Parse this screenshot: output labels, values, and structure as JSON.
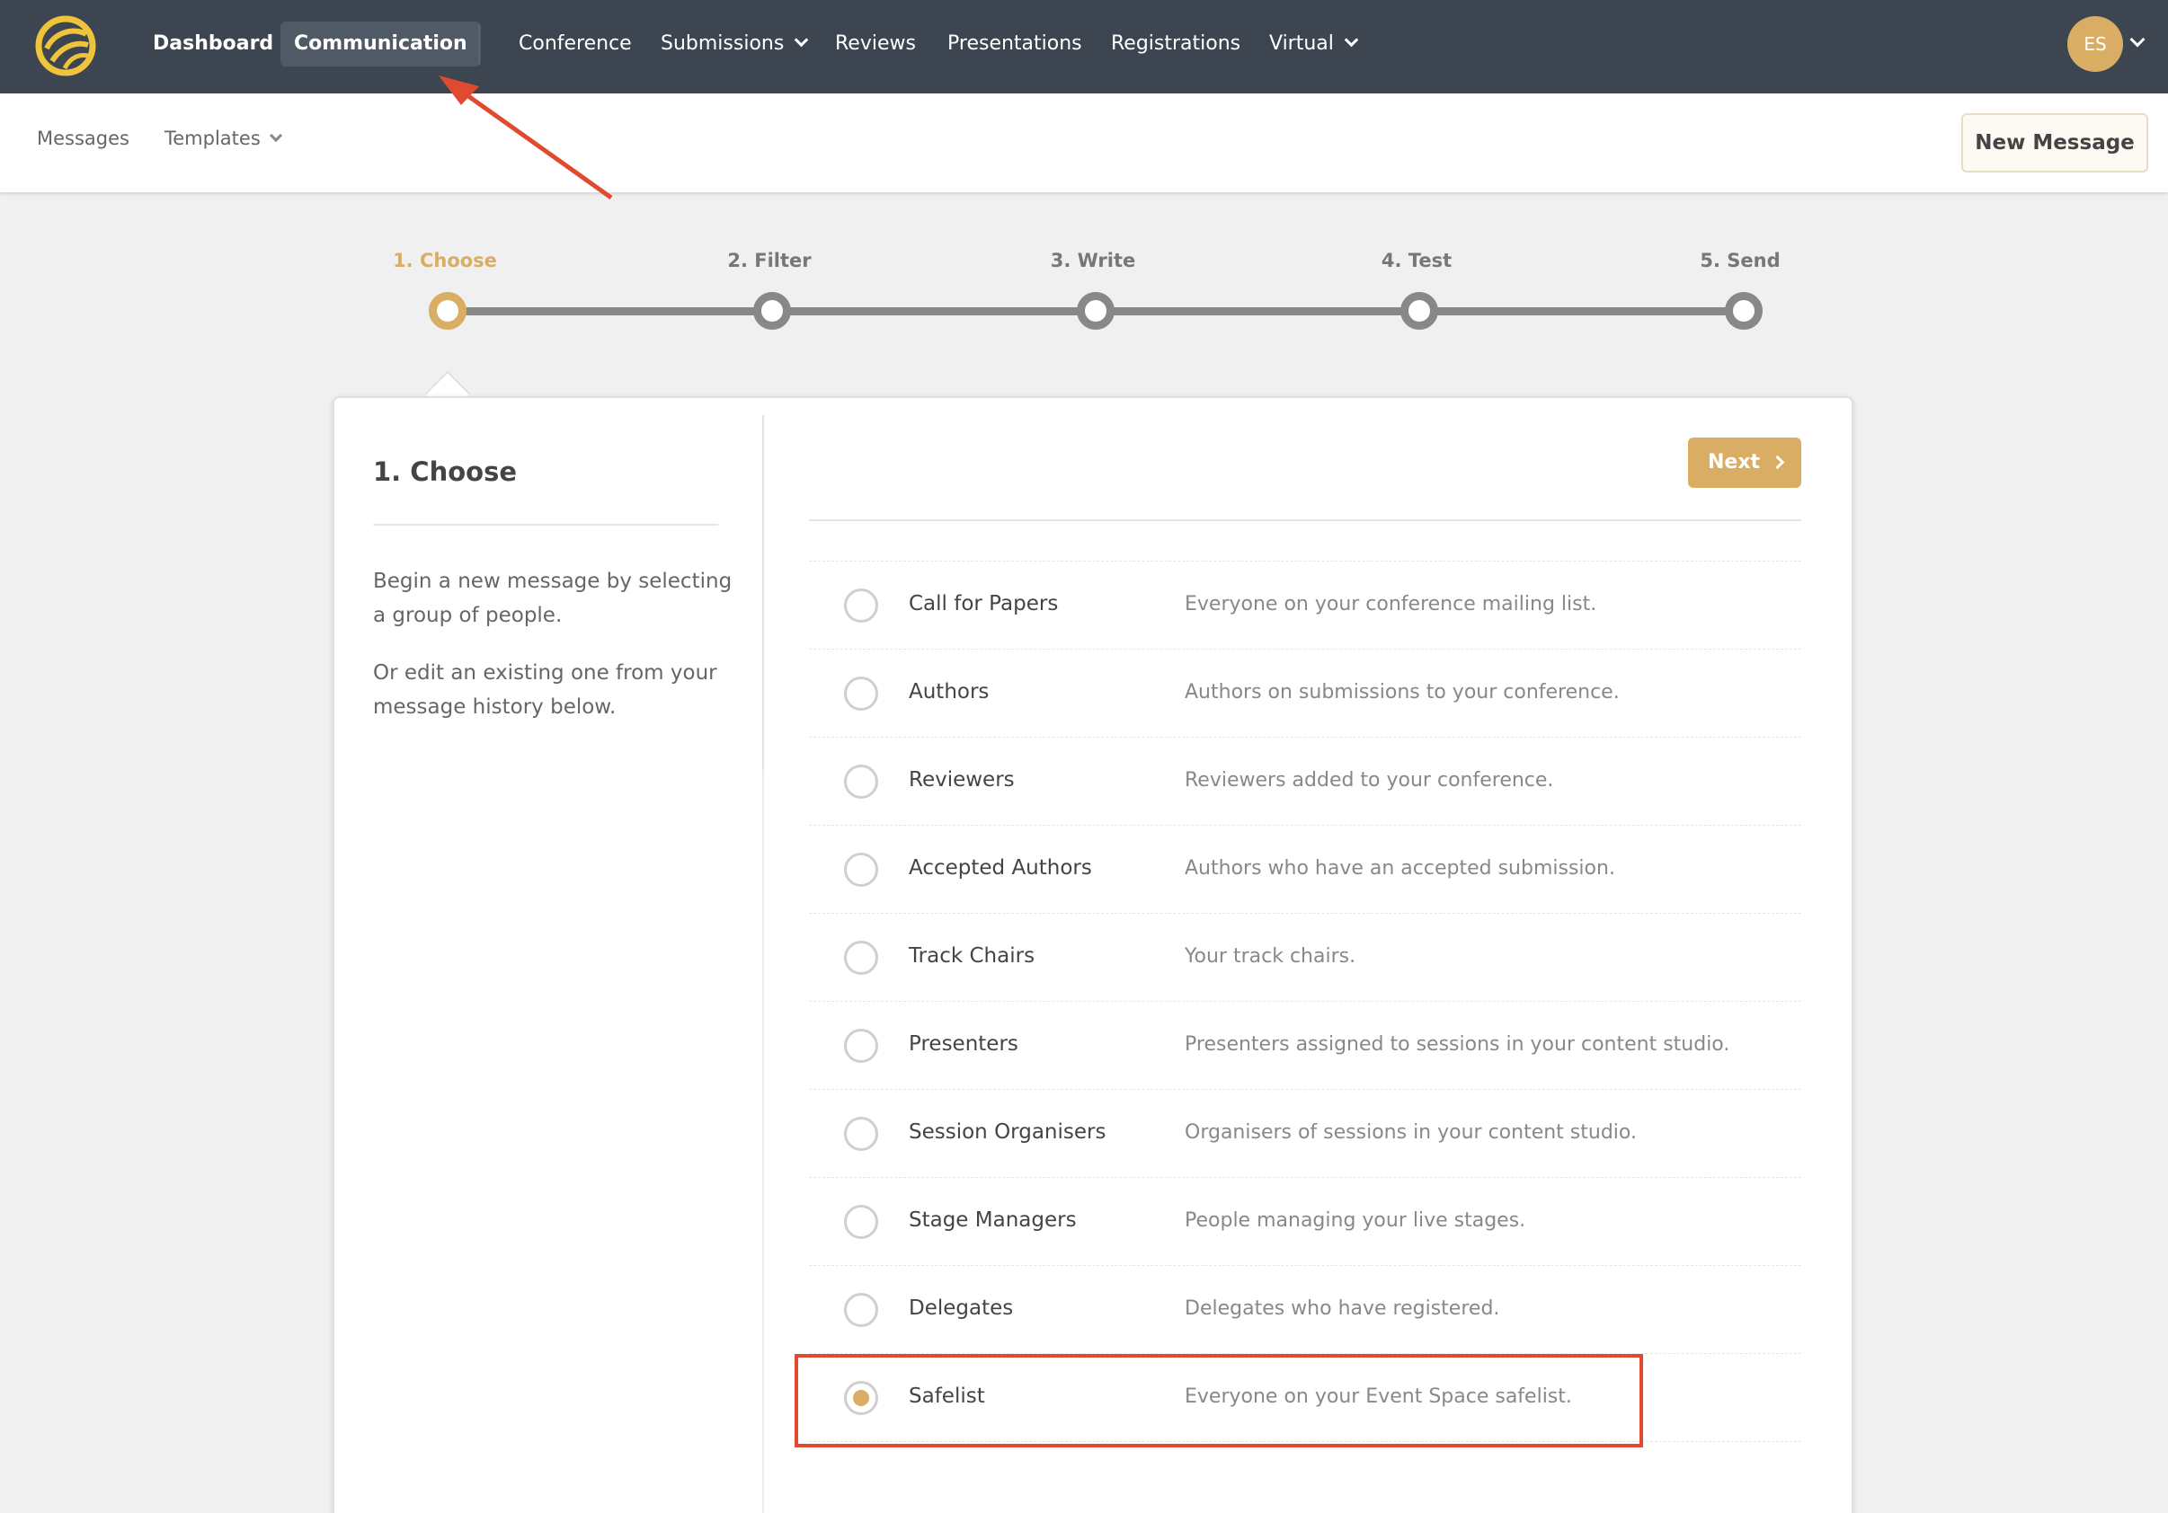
{
  "topnav": {
    "items": [
      {
        "label": "Dashboard"
      },
      {
        "label": "Communication"
      },
      {
        "label": "Conference"
      },
      {
        "label": "Submissions"
      },
      {
        "label": "Reviews"
      },
      {
        "label": "Presentations"
      },
      {
        "label": "Registrations"
      },
      {
        "label": "Virtual"
      }
    ],
    "avatar_initials": "ES"
  },
  "subnav": {
    "messages": "Messages",
    "templates": "Templates",
    "new_message": "New Message"
  },
  "stepper": {
    "steps": [
      {
        "label": "1. Choose"
      },
      {
        "label": "2. Filter"
      },
      {
        "label": "3. Write"
      },
      {
        "label": "4. Test"
      },
      {
        "label": "5. Send"
      }
    ],
    "active_index": 0
  },
  "left_panel": {
    "title": "1. Choose",
    "para1": "Begin a new message by selecting a group of people.",
    "para2": "Or edit an existing one from your message history below."
  },
  "right_panel": {
    "next_label": "Next",
    "options": [
      {
        "name": "Call for Papers",
        "desc": "Everyone on your conference mailing list.",
        "checked": false
      },
      {
        "name": "Authors",
        "desc": "Authors on submissions to your conference.",
        "checked": false
      },
      {
        "name": "Reviewers",
        "desc": "Reviewers added to your conference.",
        "checked": false
      },
      {
        "name": "Accepted Authors",
        "desc": "Authors who have an accepted submission.",
        "checked": false
      },
      {
        "name": "Track Chairs",
        "desc": "Your track chairs.",
        "checked": false
      },
      {
        "name": "Presenters",
        "desc": "Presenters assigned to sessions in your content studio.",
        "checked": false
      },
      {
        "name": "Session Organisers",
        "desc": "Organisers of sessions in your content studio.",
        "checked": false
      },
      {
        "name": "Stage Managers",
        "desc": "People managing your live stages.",
        "checked": false
      },
      {
        "name": "Delegates",
        "desc": "Delegates who have registered.",
        "checked": false
      },
      {
        "name": "Safelist",
        "desc": "Everyone on your Event Space safelist.",
        "checked": true
      }
    ]
  },
  "colors": {
    "nav_bg": "#3d4650",
    "accent": "#d9ad63",
    "annotation": "#e04a2f"
  }
}
